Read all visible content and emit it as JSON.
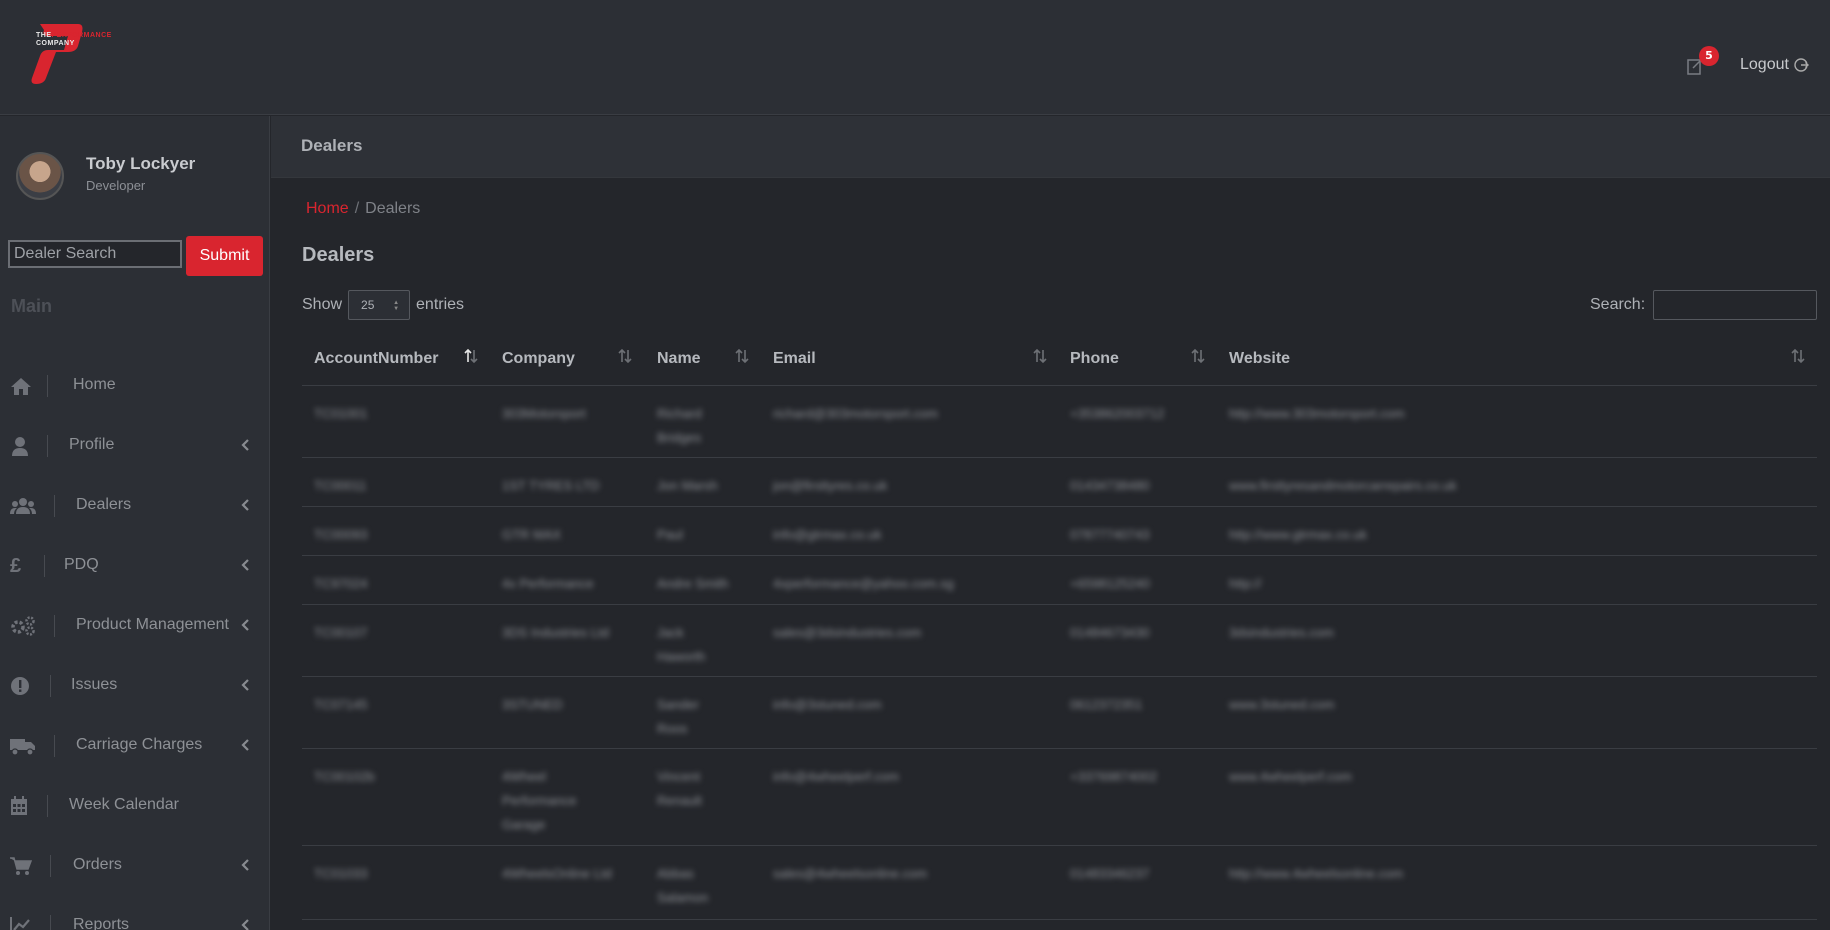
{
  "brand": {
    "logo_line1_a": "THE",
    "logo_line1_b": "PERFORMANCE",
    "logo_line2": "COMPANY",
    "accent": "#d9252f"
  },
  "topbar": {
    "notification_count": "5",
    "logout_label": "Logout"
  },
  "user": {
    "name": "Toby Lockyer",
    "role": "Developer"
  },
  "sidebar": {
    "search_placeholder": "Dealer Search",
    "submit_label": "Submit",
    "section_label": "Main",
    "items": [
      {
        "label": "Home",
        "icon": "home-icon",
        "has_submenu": false
      },
      {
        "label": "Profile",
        "icon": "user-icon",
        "has_submenu": true
      },
      {
        "label": "Dealers",
        "icon": "users-icon",
        "has_submenu": true
      },
      {
        "label": "PDQ",
        "icon": "pound-icon",
        "has_submenu": true
      },
      {
        "label": "Product Management",
        "icon": "cogs-icon",
        "has_submenu": true
      },
      {
        "label": "Issues",
        "icon": "alert-icon",
        "has_submenu": true
      },
      {
        "label": "Carriage Charges",
        "icon": "truck-icon",
        "has_submenu": true
      },
      {
        "label": "Week Calendar",
        "icon": "calendar-icon",
        "has_submenu": false
      },
      {
        "label": "Orders",
        "icon": "cart-icon",
        "has_submenu": true
      },
      {
        "label": "Reports",
        "icon": "chart-icon",
        "has_submenu": true
      }
    ]
  },
  "page": {
    "header_title": "Dealers",
    "breadcrumb_home": "Home",
    "breadcrumb_sep": "/",
    "breadcrumb_current": "Dealers",
    "title": "Dealers"
  },
  "table_controls": {
    "show_label": "Show",
    "page_size": "25",
    "entries_label": "entries",
    "search_label": "Search:"
  },
  "table": {
    "columns": [
      "AccountNumber",
      "Company",
      "Name",
      "Email",
      "Phone",
      "Website"
    ],
    "rows": [
      [
        "TC01001",
        "303Motorsport",
        "Richard Bridges",
        "richard@303motorsport.com",
        "+353862003712",
        "http://www.303motorsport.com"
      ],
      [
        "TC00011",
        "1ST TYRES LTD",
        "Jon Marsh",
        "jon@firsttyres.co.uk",
        "01434738480",
        "www.firsttyresandmotorcarrepairs.co.uk"
      ],
      [
        "TC00093",
        "GTR MAX",
        "Paul",
        "info@gtrmax.co.uk",
        "07877740743",
        "http://www.gtrmax.co.uk"
      ],
      [
        "TC97024",
        "4x Performance",
        "Andre Smith",
        "4xperformance@yahoo.com.sg",
        "+6598125240",
        "http://"
      ],
      [
        "TC00107",
        "3DS Industries Ltd",
        "Jack Haworth",
        "sales@3dsindustries.com",
        "01484673430",
        "3dsindustries.com"
      ],
      [
        "TC07145",
        "3STUNED",
        "Sander Roos",
        "info@3stuned.com",
        "0612372351",
        "www.3stuned.com"
      ],
      [
        "TC00102b",
        "4Wheel Performance Garage",
        "Vincent Renault",
        "info@4wheelperf.com",
        "+33769874002",
        "www.4wheelperf.com"
      ],
      [
        "TC01033",
        "4WheelsOnline Ltd",
        "Abbas Salamon",
        "sales@4wheelsonline.com",
        "01483346237",
        "http://www.4wheelsonline.com"
      ]
    ]
  }
}
